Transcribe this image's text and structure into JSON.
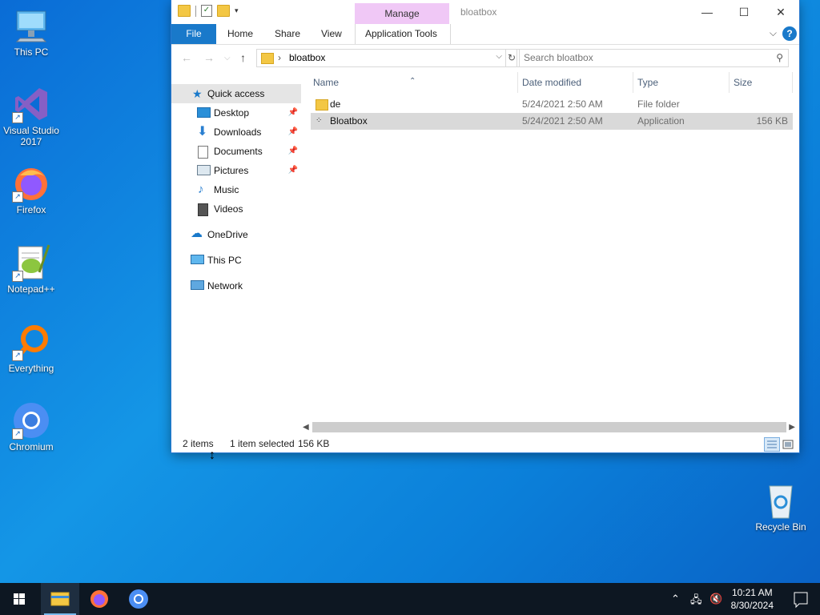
{
  "desktop": {
    "icons": [
      {
        "label": "This PC"
      },
      {
        "label": "Visual Studio 2017"
      },
      {
        "label": "Firefox"
      },
      {
        "label": "Notepad++"
      },
      {
        "label": "Everything"
      },
      {
        "label": "Chromium"
      },
      {
        "label": "Recycle Bin"
      }
    ]
  },
  "window": {
    "title": "bloatbox",
    "manage_tab": "Manage",
    "ribbon_tabs": [
      "File",
      "Home",
      "Share",
      "View",
      "Application Tools"
    ],
    "address": {
      "path": "bloatbox"
    },
    "search": {
      "placeholder": "Search bloatbox"
    },
    "nav_pane": {
      "quick_access": "Quick access",
      "quick_items": [
        "Desktop",
        "Downloads",
        "Documents",
        "Pictures",
        "Music",
        "Videos"
      ],
      "onedrive": "OneDrive",
      "this_pc": "This PC",
      "network": "Network"
    },
    "columns": {
      "name": "Name",
      "date": "Date modified",
      "type": "Type",
      "size": "Size"
    },
    "files": [
      {
        "name": "de",
        "date": "5/24/2021 2:50 AM",
        "type": "File folder",
        "size": ""
      },
      {
        "name": "Bloatbox",
        "date": "5/24/2021 2:50 AM",
        "type": "Application",
        "size": "156 KB"
      }
    ],
    "status": {
      "items": "2 items",
      "selected": "1 item selected",
      "size": "156 KB"
    }
  },
  "taskbar": {
    "time": "10:21 AM",
    "date": "8/30/2024"
  },
  "colors": {
    "accent": "#1979ca",
    "manage": "#f0c8f6",
    "selection": "#d9d9d9"
  }
}
